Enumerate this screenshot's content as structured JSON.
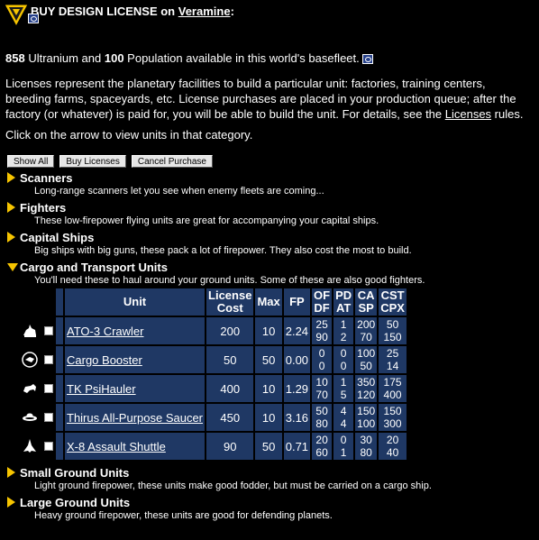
{
  "header": {
    "title_prefix": "BUY DESIGN LICENSE on ",
    "world": "Veramine",
    "colon": ":"
  },
  "resources": {
    "ultranium": "858",
    "ultranium_label": " Ultranium and ",
    "population": "100",
    "population_label": " Population available in this world's basefleet. "
  },
  "description": {
    "text": "Licenses represent the planetary facilities to build a particular unit: factories, training centers, breeding farms, spaceyards, etc. License purchases are placed in your production queue; after the factory (or whatever) is paid for, you will be able to build the unit. For details, see the ",
    "link": "Licenses",
    "suffix": " rules."
  },
  "instruction": "Click on the arrow to view units in that category.",
  "buttons": {
    "show_all": "Show All",
    "buy_licenses": "Buy Licenses",
    "cancel_purchase": "Cancel Purchase"
  },
  "categories": [
    {
      "name": "Scanners",
      "desc": "Long-range scanners let you see when enemy fleets are coming..."
    },
    {
      "name": "Fighters",
      "desc": "These low-firepower flying units are great for accompanying your capital ships."
    },
    {
      "name": "Capital Ships",
      "desc": "Big ships with big guns, these pack a lot of firepower. They also cost the most to build."
    },
    {
      "name": "Cargo and Transport Units",
      "desc": "You'll need these to haul around your ground units. Some of these are also good fighters."
    },
    {
      "name": "Small Ground Units",
      "desc": "Light ground firepower, these units make good fodder, but must be carried on a cargo ship."
    },
    {
      "name": "Large Ground Units",
      "desc": "Heavy ground firepower, these units are good for defending planets."
    }
  ],
  "table": {
    "headers": {
      "unit": "Unit",
      "license_cost_1": "License",
      "license_cost_2": "Cost",
      "max": "Max",
      "fp": "FP",
      "of": "OF",
      "df": "DF",
      "pd": "PD",
      "at": "AT",
      "ca": "CA",
      "sp": "SP",
      "cst": "CST",
      "cpx": "CPX"
    },
    "rows": [
      {
        "name": "ATO-3 Crawler",
        "icon": "crawler-icon",
        "cost": "200",
        "max": "10",
        "fp": "2.24",
        "of": "25",
        "df": "90",
        "pd": "1",
        "at": "2",
        "ca": "200",
        "sp": "70",
        "cst": "50",
        "cpx": "150"
      },
      {
        "name": "Cargo Booster",
        "icon": "booster-icon",
        "cost": "50",
        "max": "50",
        "fp": "0.00",
        "of": "0",
        "df": "0",
        "pd": "0",
        "at": "0",
        "ca": "100",
        "sp": "50",
        "cst": "25",
        "cpx": "14"
      },
      {
        "name": "TK PsiHauler",
        "icon": "hauler-icon",
        "cost": "400",
        "max": "10",
        "fp": "1.29",
        "of": "10",
        "df": "70",
        "pd": "1",
        "at": "5",
        "ca": "350",
        "sp": "120",
        "cst": "175",
        "cpx": "400"
      },
      {
        "name": "Thirus All-Purpose Saucer",
        "icon": "saucer-icon",
        "cost": "450",
        "max": "10",
        "fp": "3.16",
        "of": "50",
        "df": "80",
        "pd": "4",
        "at": "4",
        "ca": "150",
        "sp": "100",
        "cst": "150",
        "cpx": "300"
      },
      {
        "name": "X-8 Assault Shuttle",
        "icon": "shuttle-icon",
        "cost": "90",
        "max": "50",
        "fp": "0.71",
        "of": "20",
        "df": "60",
        "pd": "0",
        "at": "1",
        "ca": "30",
        "sp": "80",
        "cst": "20",
        "cpx": "40"
      }
    ]
  },
  "colors": {
    "accent": "#f6c400",
    "table_bg": "#1f3864"
  }
}
